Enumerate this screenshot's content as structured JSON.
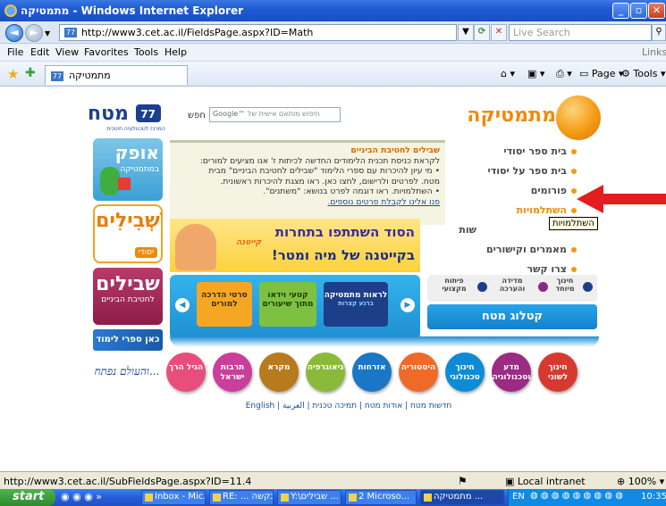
{
  "window": {
    "title": "מתמטיקה - Windows Internet Explorer"
  },
  "addressbar": {
    "url": "http://www3.cet.ac.il/FieldsPage.aspx?ID=Math",
    "search_placeholder": "Live Search",
    "links_label": "Links"
  },
  "menu": [
    "File",
    "Edit",
    "View",
    "Favorites",
    "Tools",
    "Help"
  ],
  "tab": {
    "label": "מתמטיקה"
  },
  "commandbar": {
    "page": "Page",
    "tools": "Tools"
  },
  "page": {
    "logo_text": "מטח",
    "logo_subtitle": "המרכז לטכנולוגיה חינוכית",
    "search_label": "חפש",
    "search_placeholder": "חיפוש מותאם אישית של",
    "search_brand": "Google™",
    "section_title": "מתמטיקה",
    "nav_items": [
      "בית ספר יסודי",
      "בית ספר על יסודי",
      "פורומים",
      "השתלמויות",
      "מאמרים וקישורים",
      "צרו קשר"
    ],
    "nav_hidden_partial": "שות",
    "tooltip": "השתלמויות",
    "news_title": "שבילים לחטיבת הביניים",
    "news_lines": [
      "לקראת כניסת תכנית הלימודים החדשה לכיתות ז' אנו מציעים למורים:",
      "• מי עיון להיכרות עם ספרי הלימוד \"שבילים לחטיבת הביניים\" מבית",
      "מטח. לפרטים ולרישום, לחצו כאן. ראו מצגת להיכרות ראשונית.",
      "• השתלמויות. ראו דוגמה לפרט בנושא: \"משתנים\".",
      "פנו אלינו לקבלת פרטים נוספים."
    ],
    "ofek_label": "אופק",
    "ofek_sub": "במתמטיקה",
    "shvilim_label": "שְׁבִילִים",
    "shvilim_sub": "יסודי",
    "shvilim2_label": "שבילים",
    "shvilim2_sub": "לחטיבת הביניים",
    "kan_label": "כאן ספרי לימוד",
    "banner_title": "הסוד השתתפו בתחרות",
    "banner_sub": "בקייטנה של מיה ומטר!",
    "banner_word": "קייטנה",
    "carousel_items": [
      "סרטי הדרכה למורים",
      "קטעי וידאו מתוך שיעורים",
      "לראות מתמטיקה"
    ],
    "carousel_third_sub": "ברגע קצרות",
    "right_buttons": [
      "פיתוח מקצועי",
      "מדידה והערכה",
      "חינוך מיוחד"
    ],
    "catalog_label": "קטלוג מטח",
    "tagline": "והעולם נפתח...",
    "circles": [
      "הגיל הרך",
      "תרבות ישראל",
      "מקרא",
      "גיאוגרפיה",
      "אזרחות",
      "היסטוריה",
      "חינוך טכנולוגי",
      "מדע וטכנולוגיה",
      "חינוך לשוני"
    ],
    "circle_colors": [
      "#e94d7b",
      "#c93f9a",
      "#b77a1d",
      "#8bb93a",
      "#1a76c6",
      "#ef6a29",
      "#0f8bd6",
      "#9b2b83",
      "#d63a2e"
    ],
    "footer_links": [
      "English",
      "العربية",
      "תמיכה טכנית",
      "אודות מטח",
      "חדשות מטח"
    ]
  },
  "statusbar": {
    "url": "http://www3.cet.ac.il/SubFieldsPage.aspx?ID=11.4",
    "zone": "Local intranet",
    "zoom": "100%"
  },
  "taskbar": {
    "start": "start",
    "tasks": [
      "Inbox - Mic...",
      "RE: ... בקשה",
      "Y:\\שבילים ...",
      "2 Microso...",
      "מתמטיקה ..."
    ],
    "lang": "EN",
    "clock": "10:35"
  }
}
